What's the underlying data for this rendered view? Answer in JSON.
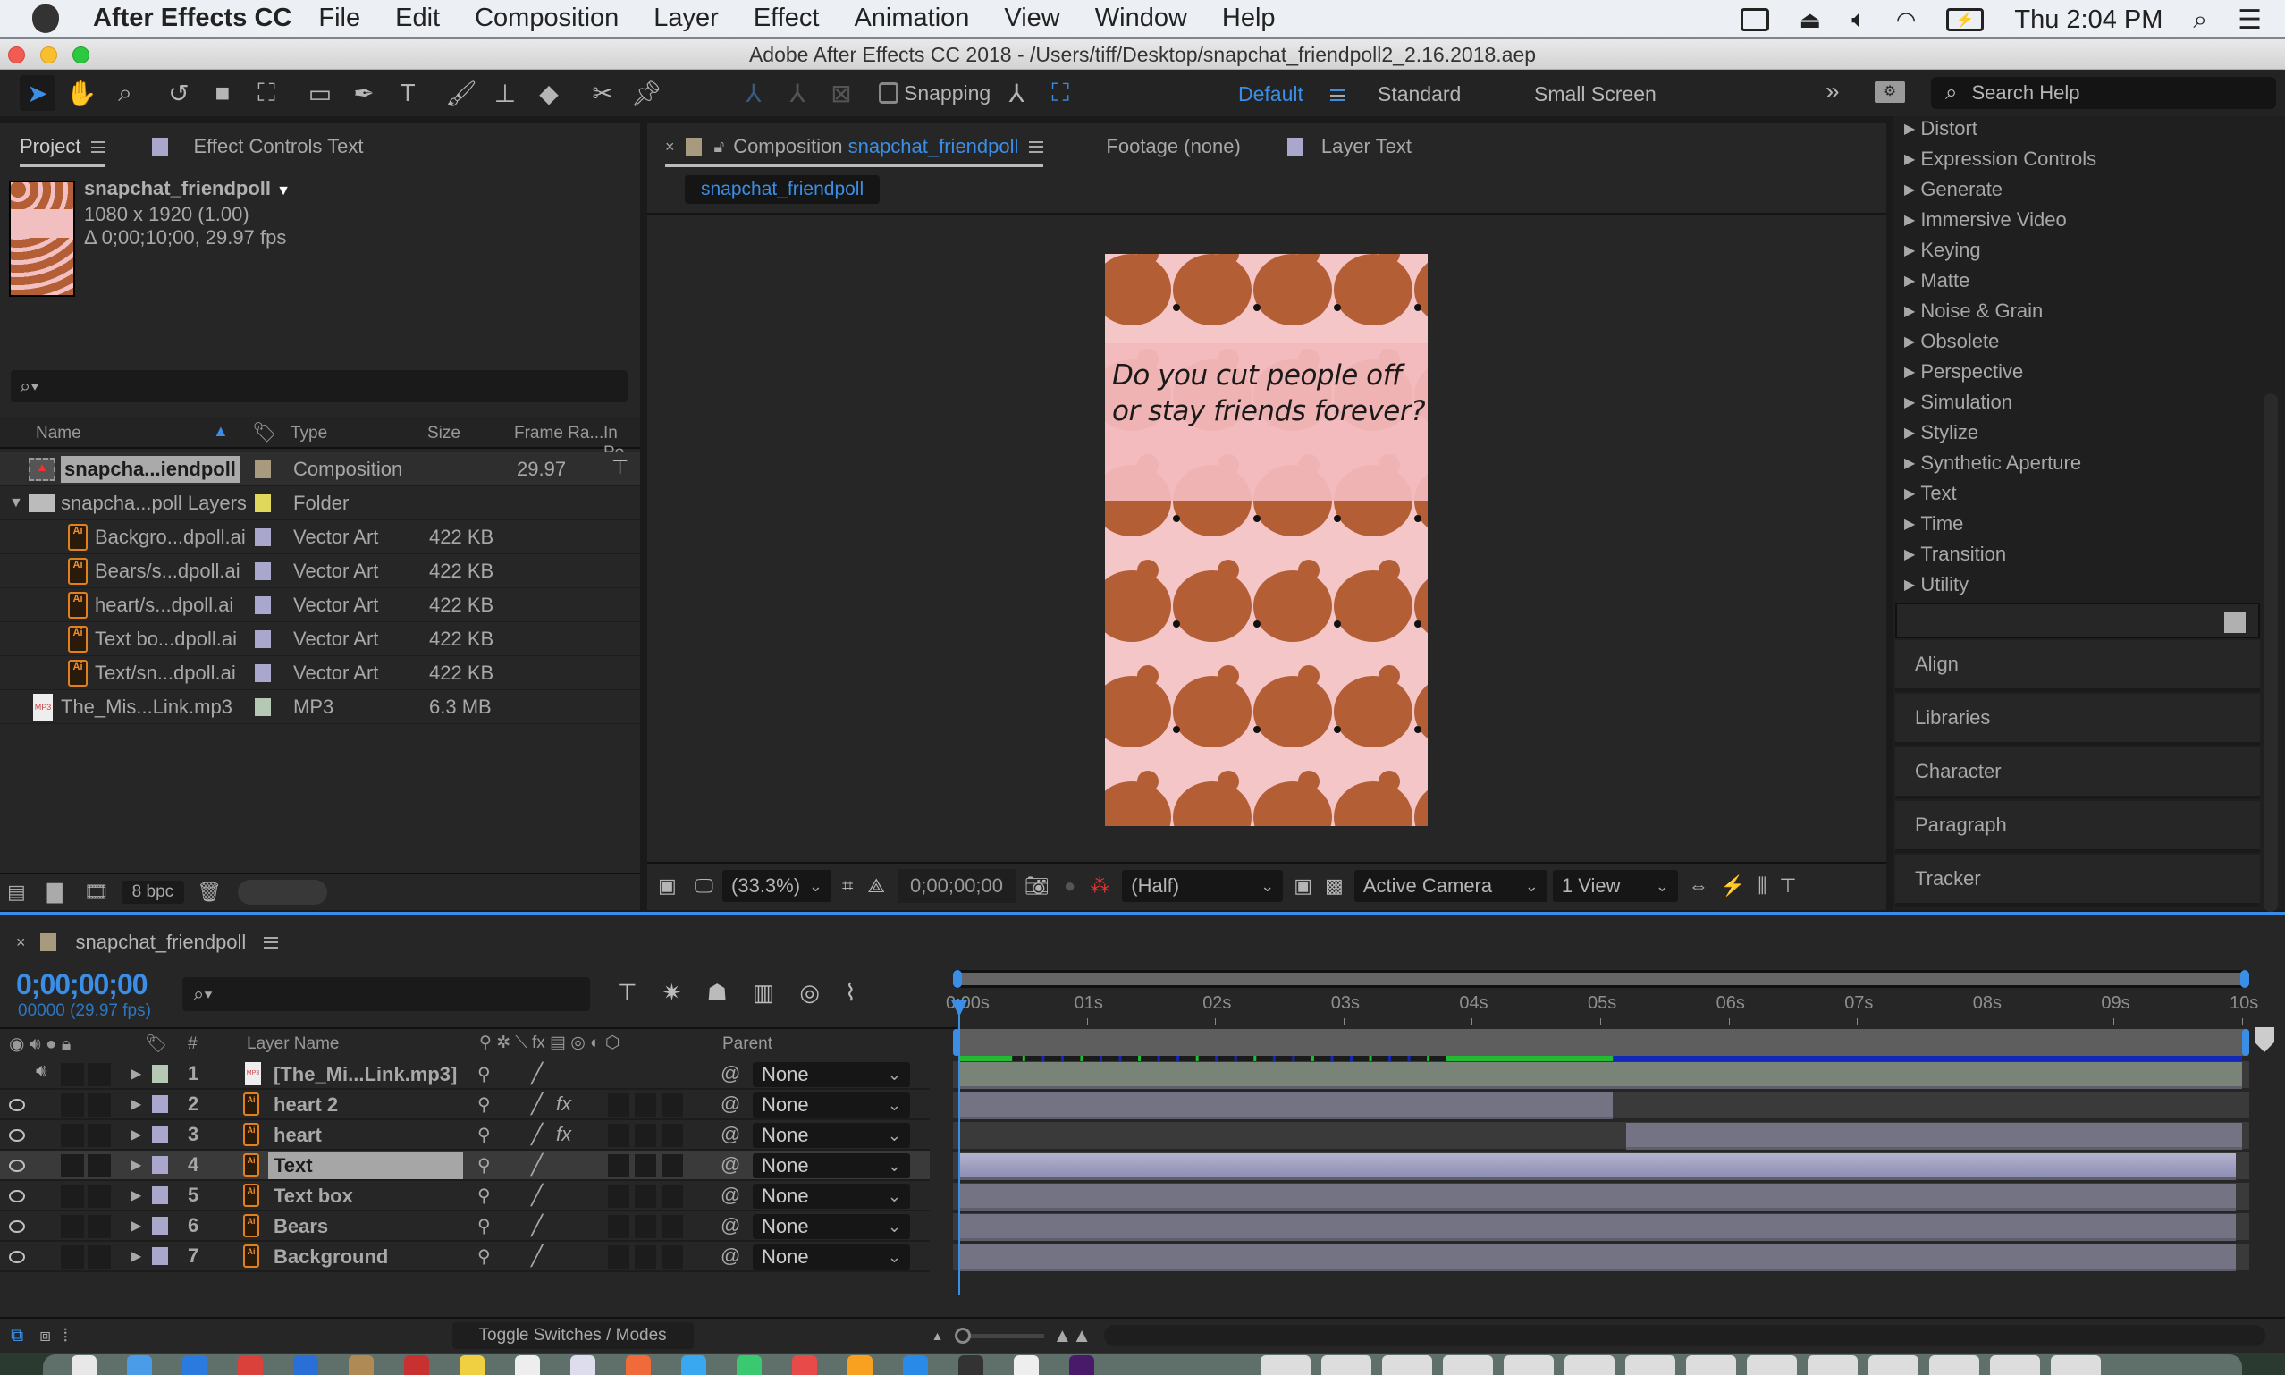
{
  "menubar": {
    "app_name": "After Effects CC",
    "menus": [
      "File",
      "Edit",
      "Composition",
      "Layer",
      "Effect",
      "Animation",
      "View",
      "Window",
      "Help"
    ],
    "clock": "Thu 2:04 PM",
    "status_icons": [
      "display-icon",
      "airplay-icon",
      "volume-icon",
      "wifi-icon",
      "battery-icon",
      "spotlight-icon",
      "notification-list-icon"
    ]
  },
  "window": {
    "title": "Adobe After Effects CC 2018 - /Users/tiff/Desktop/snapchat_friendpoll2_2.16.2018.aep"
  },
  "toolbar": {
    "tools": [
      "selection-tool",
      "hand-tool",
      "zoom-tool",
      "rotation-tool",
      "camera-tool",
      "pan-behind-tool",
      "rectangle-tool",
      "pen-tool",
      "type-tool",
      "brush-tool",
      "clone-stamp-tool",
      "eraser-tool",
      "roto-brush-tool",
      "puppet-pin-tool"
    ],
    "snapping_label": "Snapping",
    "snapping_checked": false,
    "workspaces": {
      "active": "Default",
      "others": [
        "Standard",
        "Small Screen"
      ]
    },
    "search_placeholder": "Search Help"
  },
  "project_panel": {
    "tabs": [
      "Project",
      "Effect Controls Text"
    ],
    "selected_item": {
      "name": "snapchat_friendpoll",
      "dimensions": "1080 x 1920 (1.00)",
      "duration": "Δ 0;00;10;00, 29.97 fps"
    },
    "search_placeholder": "",
    "columns": [
      "Name",
      "Type",
      "Size",
      "Frame Ra...",
      "In Po"
    ],
    "items": [
      {
        "name": "snapcha...iendpoll",
        "type": "Composition",
        "size": "",
        "frame_rate": "29.97",
        "label_color": "#a89a7e",
        "icon": "composition-icon",
        "indent": 0,
        "selected": true
      },
      {
        "name": "snapcha...poll Layers",
        "type": "Folder",
        "size": "",
        "frame_rate": "",
        "label_color": "#e0d85a",
        "icon": "folder-icon",
        "indent": 0,
        "expanded": true
      },
      {
        "name": "Backgro...dpoll.ai",
        "type": "Vector Art",
        "size": "422 KB",
        "frame_rate": "",
        "label_color": "#a9a8cc",
        "icon": "illustrator-file-icon",
        "indent": 1
      },
      {
        "name": "Bears/s...dpoll.ai",
        "type": "Vector Art",
        "size": "422 KB",
        "frame_rate": "",
        "label_color": "#a9a8cc",
        "icon": "illustrator-file-icon",
        "indent": 1
      },
      {
        "name": "heart/s...dpoll.ai",
        "type": "Vector Art",
        "size": "422 KB",
        "frame_rate": "",
        "label_color": "#a9a8cc",
        "icon": "illustrator-file-icon",
        "indent": 1
      },
      {
        "name": "Text bo...dpoll.ai",
        "type": "Vector Art",
        "size": "422 KB",
        "frame_rate": "",
        "label_color": "#a9a8cc",
        "icon": "illustrator-file-icon",
        "indent": 1
      },
      {
        "name": "Text/sn...dpoll.ai",
        "type": "Vector Art",
        "size": "422 KB",
        "frame_rate": "",
        "label_color": "#a9a8cc",
        "icon": "illustrator-file-icon",
        "indent": 1
      },
      {
        "name": "The_Mis...Link.mp3",
        "type": "MP3",
        "size": "6.3 MB",
        "frame_rate": "",
        "label_color": "#b4c8b4",
        "icon": "mp3-file-icon",
        "indent": 0
      }
    ],
    "bit_depth": "8 bpc"
  },
  "composition_panel": {
    "tabs": [
      {
        "prefix": "Composition",
        "name": "snapchat_friendpoll",
        "active": true
      },
      {
        "prefix": "Footage (none)",
        "name": "",
        "active": false
      },
      {
        "prefix": "Layer Text",
        "name": "",
        "active": false
      }
    ],
    "breadcrumb": "snapchat_friendpoll",
    "canvas_text": [
      "Do you cut people off",
      "or stay friends forever?"
    ],
    "magnification": "(33.3%)",
    "timecode": "0;00;00;00",
    "resolution": "(Half)",
    "camera": "Active Camera",
    "views": "1 View"
  },
  "effects_panel": {
    "categories": [
      "Distort",
      "Expression Controls",
      "Generate",
      "Immersive Video",
      "Keying",
      "Matte",
      "Noise & Grain",
      "Obsolete",
      "Perspective",
      "Simulation",
      "Stylize",
      "Synthetic Aperture",
      "Text",
      "Time",
      "Transition",
      "Utility"
    ],
    "collapsed_panels": [
      "Align",
      "Libraries",
      "Character",
      "Paragraph",
      "Tracker"
    ]
  },
  "timeline": {
    "comp_name": "snapchat_friendpoll",
    "current_time": "0;00;00;00",
    "frame_info": "00000 (29.97 fps)",
    "columns": {
      "number": "#",
      "layer_name": "Layer Name",
      "parent": "Parent"
    },
    "ruler_ticks": [
      "0:00s",
      "01s",
      "02s",
      "03s",
      "04s",
      "05s",
      "06s",
      "07s",
      "08s",
      "09s",
      "10s"
    ],
    "duration_seconds": 10,
    "current_time_seconds": 0,
    "layers": [
      {
        "num": "1",
        "name": "[The_Mi...Link.mp3]",
        "label_color": "#b4c8b4",
        "icon": "mp3-file-icon",
        "audio": true,
        "video": false,
        "fx": false,
        "parent": "None",
        "bar_start": 0,
        "bar_end": 10,
        "bar_color": "#7a8377",
        "selected": false
      },
      {
        "num": "2",
        "name": "heart 2",
        "label_color": "#a9a8cc",
        "icon": "illustrator-file-icon",
        "audio": false,
        "video": true,
        "fx": true,
        "parent": "None",
        "bar_start": 0,
        "bar_end": 5.1,
        "bar_color": "#747383",
        "selected": false
      },
      {
        "num": "3",
        "name": "heart",
        "label_color": "#a9a8cc",
        "icon": "illustrator-file-icon",
        "audio": false,
        "video": true,
        "fx": true,
        "parent": "None",
        "bar_start": 5.2,
        "bar_end": 10,
        "bar_color": "#747383",
        "selected": false
      },
      {
        "num": "4",
        "name": "Text",
        "label_color": "#a9a8cc",
        "icon": "illustrator-file-icon",
        "audio": false,
        "video": true,
        "fx": false,
        "parent": "None",
        "bar_start": 0,
        "bar_end": 9.95,
        "bar_color": "#9d9cbf",
        "selected": true
      },
      {
        "num": "5",
        "name": "Text box",
        "label_color": "#a9a8cc",
        "icon": "illustrator-file-icon",
        "audio": false,
        "video": true,
        "fx": false,
        "parent": "None",
        "bar_start": 0,
        "bar_end": 9.95,
        "bar_color": "#747383",
        "selected": false
      },
      {
        "num": "6",
        "name": "Bears",
        "label_color": "#a9a8cc",
        "icon": "illustrator-file-icon",
        "audio": false,
        "video": true,
        "fx": false,
        "parent": "None",
        "bar_start": 0,
        "bar_end": 9.95,
        "bar_color": "#747383",
        "selected": false
      },
      {
        "num": "7",
        "name": "Background",
        "label_color": "#a9a8cc",
        "icon": "illustrator-file-icon",
        "audio": false,
        "video": true,
        "fx": false,
        "parent": "None",
        "bar_start": 0,
        "bar_end": 9.95,
        "bar_color": "#747383",
        "selected": false
      }
    ],
    "toggle_label": "Toggle Switches / Modes"
  },
  "colors": {
    "accent": "#3a8ee6",
    "panel_bg": "#262626",
    "bear_brown": "#b35e35",
    "canvas_pink": "#f4c6c8",
    "render_green": "#22bb33",
    "render_blue": "#1428b8"
  }
}
